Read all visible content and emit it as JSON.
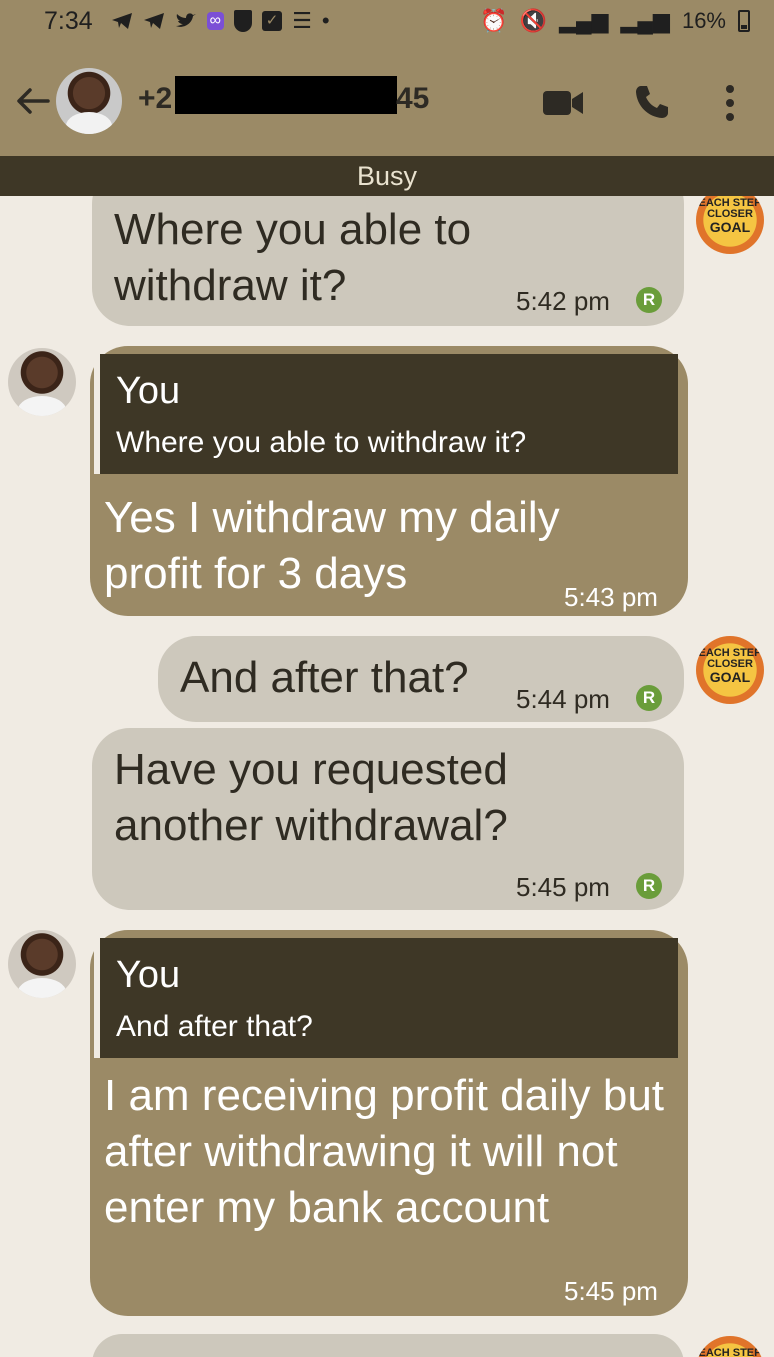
{
  "status_bar": {
    "time": "7:34",
    "battery": "16%"
  },
  "header": {
    "phone_prefix": "+2",
    "phone_suffix": "45",
    "status": "Busy"
  },
  "goal_avatar": {
    "line1": "EACH STEP",
    "line2": "CLOSER",
    "line3": "GOAL"
  },
  "messages": [
    {
      "direction": "out",
      "text": "Where you able to withdraw it?",
      "time": "5:42 pm",
      "status": "R"
    },
    {
      "direction": "in",
      "quote_author": "You",
      "quote_text": "Where you able to withdraw it?",
      "text": "Yes I withdraw my daily profit for 3 days",
      "time": "5:43 pm"
    },
    {
      "direction": "out",
      "text": "And after that?",
      "time": "5:44 pm",
      "status": "R"
    },
    {
      "direction": "out",
      "text": "Have you requested another withdrawal?",
      "time": "5:45 pm",
      "status": "R"
    },
    {
      "direction": "in",
      "quote_author": "You",
      "quote_text": "And after that?",
      "text": "I am receiving profit daily but after withdrawing it will not enter my bank account",
      "time": "5:45 pm"
    }
  ],
  "colors": {
    "header": "#9b8a66",
    "banner": "#3e3726",
    "outgoing_bubble": "#cdc8bc",
    "incoming_bubble": "#9b8a66",
    "read_receipt": "#6a9d3a"
  }
}
